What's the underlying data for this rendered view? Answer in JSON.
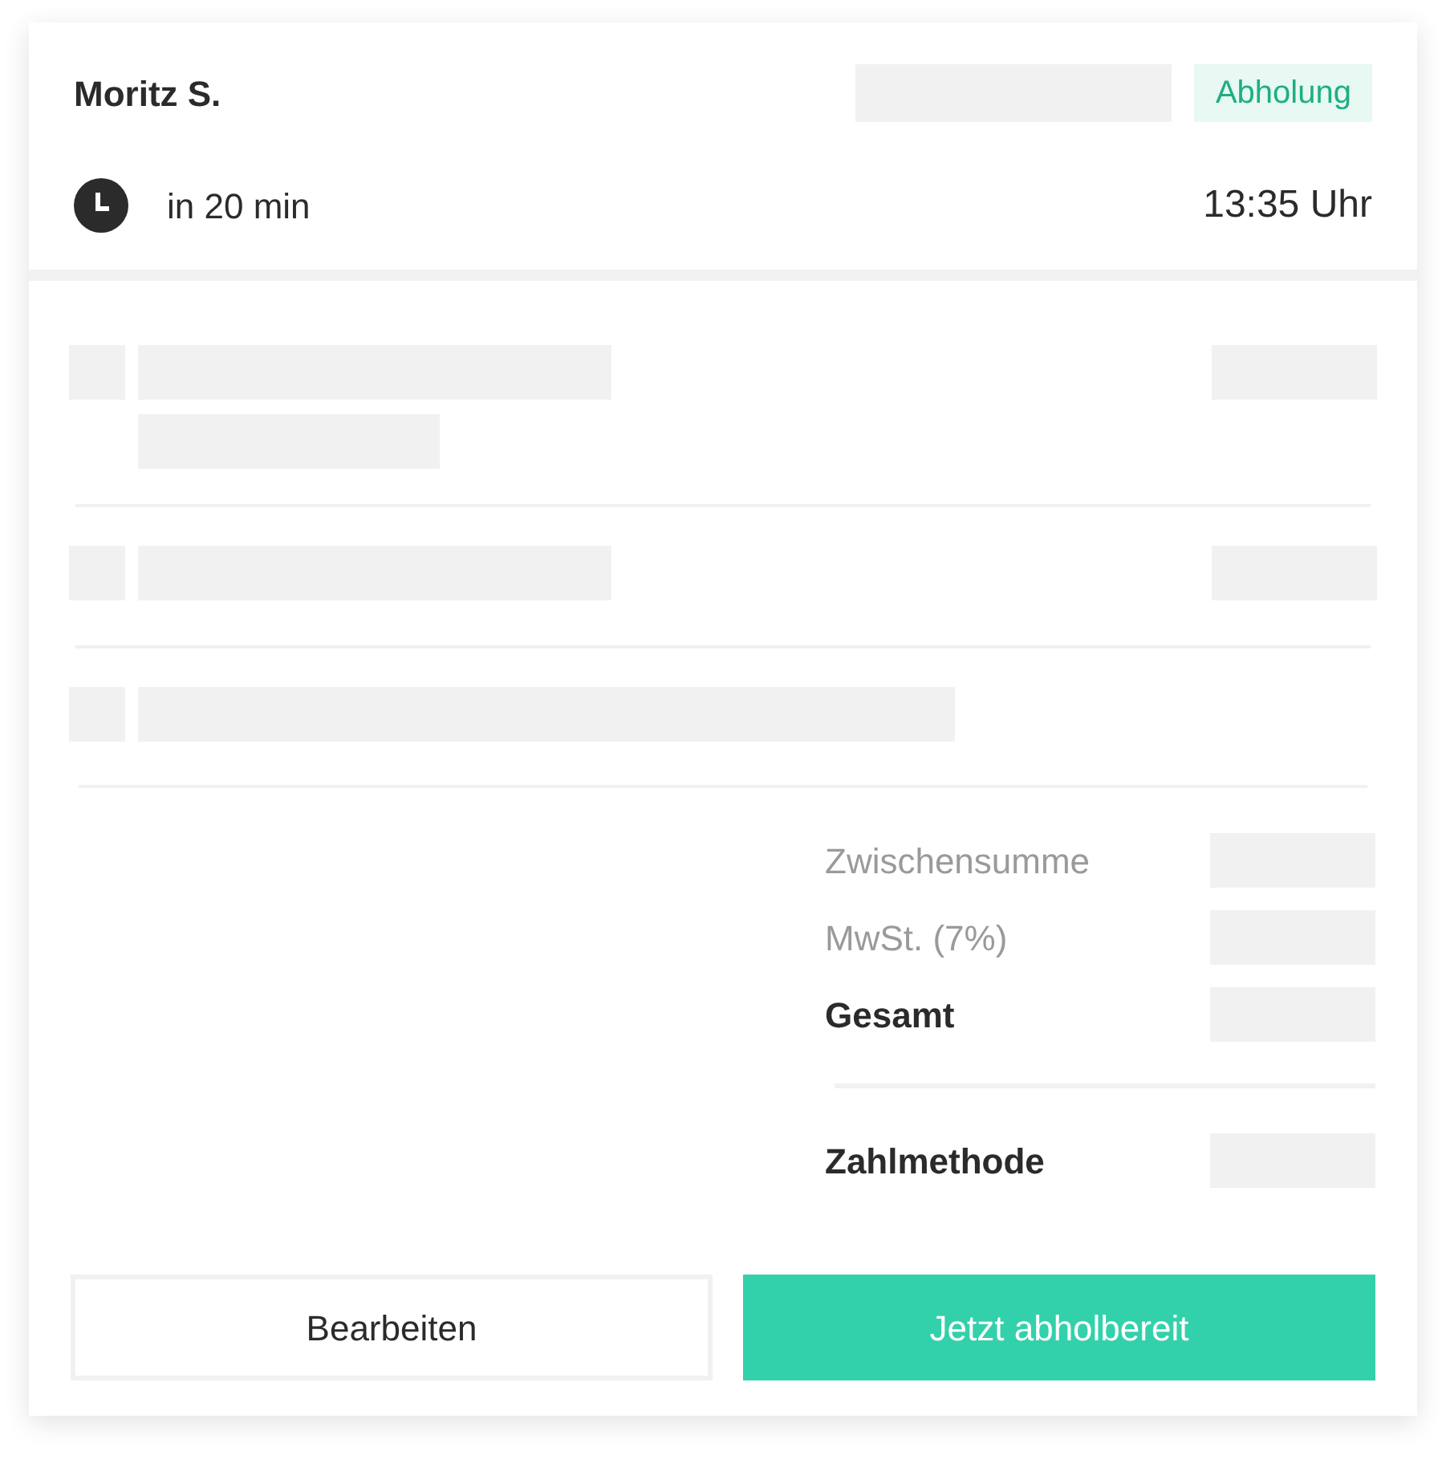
{
  "order": {
    "customer": "Moritz S.",
    "badge": "Abholung",
    "eta": "in 20 min",
    "time": "13:35 Uhr"
  },
  "summary": [
    {
      "label": "Zwischensumme",
      "kind": "muted"
    },
    {
      "label": "MwSt. (7%)",
      "kind": "muted"
    },
    {
      "label": "Gesamt",
      "kind": "strong"
    }
  ],
  "payment": {
    "label": "Zahlmethode"
  },
  "buttons": [
    {
      "label": "Bearbeiten",
      "kind": "secondary"
    },
    {
      "label": "Jetzt abholbereit",
      "kind": "primary"
    }
  ]
}
